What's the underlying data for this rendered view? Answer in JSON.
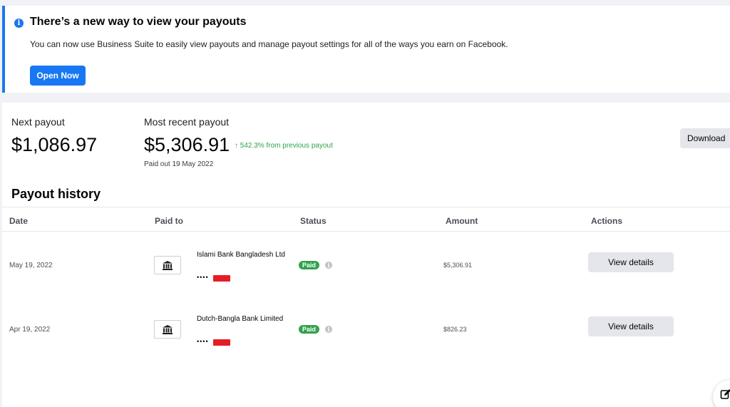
{
  "banner": {
    "title": "There’s a new way to view your payouts",
    "text": "You can now use Business Suite to easily view payouts and manage payout settings for all of the ways you earn on Facebook.",
    "button_label": "Open Now",
    "icon": "info-icon",
    "accent_color": "#1877f2"
  },
  "summary": {
    "next_label": "Next payout",
    "next_amount": "$1,086.97",
    "recent_label": "Most recent payout",
    "recent_amount": "$5,306.91",
    "trend": "↑ 542.3% from previous payout",
    "paid_out": "Paid out 19 May 2022",
    "download_label": "Download",
    "trend_color": "#31a24c"
  },
  "history": {
    "title": "Payout history",
    "columns": [
      "Date",
      "Paid to",
      "Status",
      "Amount",
      "Actions"
    ],
    "rows": [
      {
        "date": "May 19, 2022",
        "bank": "Islami Bank Bangladesh Ltd",
        "account_mask": "••••",
        "status": "Paid",
        "amount": "$5,306.91",
        "action": "View details"
      },
      {
        "date": "Apr 19, 2022",
        "bank": "Dutch-Bangla Bank Limited",
        "account_mask": "••••",
        "status": "Paid",
        "amount": "$826.23",
        "action": "View details"
      }
    ],
    "status_color": "#31a24c"
  },
  "fab": {
    "icon": "compose-icon"
  }
}
